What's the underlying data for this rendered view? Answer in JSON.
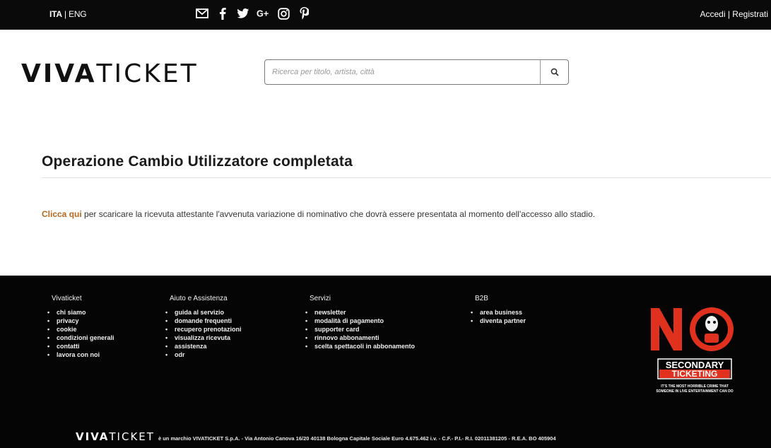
{
  "topbar": {
    "lang_active": "ITA",
    "lang_sep": " | ",
    "lang_other": "ENG",
    "social_icons": [
      "mail-icon",
      "facebook-icon",
      "twitter-icon",
      "google-plus-icon",
      "instagram-icon",
      "pinterest-icon"
    ],
    "account_links": "Accedi | Registrati"
  },
  "header": {
    "logo_bold": "VIVA",
    "logo_light": "TICKET",
    "search_placeholder": "Ricerca per titolo, artista, città"
  },
  "main": {
    "title": "Operazione Cambio Utilizzatore completata",
    "link_text": "Clicca qui",
    "message_text": " per scaricare la ricevuta attestante l'avvenuta variazione di nominativo che dovrà essere presentata al momento dell'accesso allo stadio."
  },
  "footer": {
    "columns": [
      {
        "title": "Vivaticket",
        "items": [
          "chi siamo",
          "privacy",
          "cookie",
          "condizioni generali",
          "contatti",
          "lavora con noi"
        ]
      },
      {
        "title": "Aiuto e Assistenza",
        "items": [
          "guida al servizio",
          "domande frequenti",
          "recupero prenotazioni",
          "visualizza ricevuta",
          "assistenza",
          "odr"
        ]
      },
      {
        "title": "Servizi",
        "items": [
          "newsletter",
          "modalità di pagamento",
          "supporter card",
          "rinnovo abbonamenti",
          "scelta spettacoli in abbonamento"
        ]
      },
      {
        "title": "B2B",
        "items": [
          "area business",
          "diventa partner"
        ]
      }
    ],
    "nost": {
      "line1": "SECONDARY",
      "line2": "TICKETING",
      "tag1": "IT'S THE MOST HORRIBLE CRIME THAT",
      "tag2": "SOMEONE IN LIVE ENTERTAINMENT CAN DO"
    },
    "bottom_logo_bold": "VIVA",
    "bottom_logo_light": "TICKET",
    "legal": "è un marchio VIVATICKET S.p.A. - Via Antonio Canova 16/20 40138 Bologna Capitale Sociale Euro 4.675.462 i.v. - C.F.- P.I.- R.I. 02011381205 - R.E.A. BO 405904"
  },
  "colors": {
    "accent_link": "#b5671f",
    "nost_red": "#e0301e",
    "bar": "#0a0a0a"
  }
}
